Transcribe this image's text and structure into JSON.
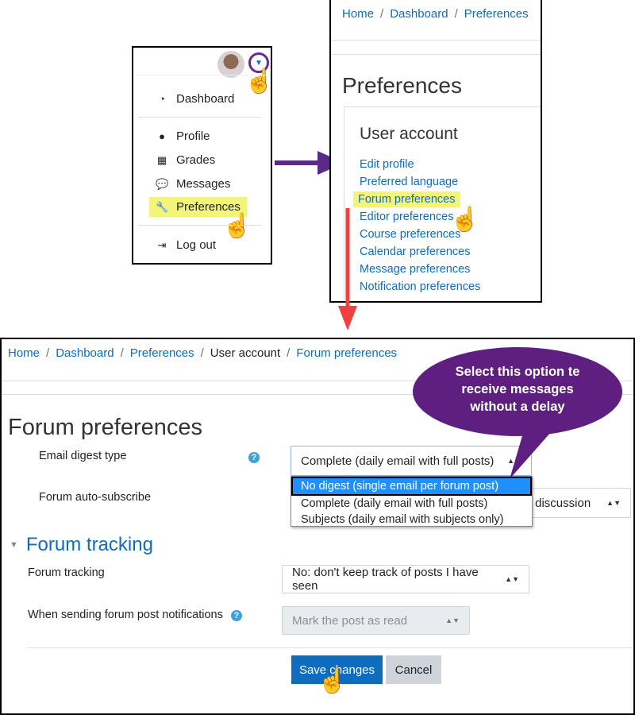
{
  "user_menu": {
    "items": [
      {
        "label": "Dashboard",
        "icon": "dashboard-icon"
      },
      {
        "label": "Profile",
        "icon": "user-icon"
      },
      {
        "label": "Grades",
        "icon": "table-icon"
      },
      {
        "label": "Messages",
        "icon": "comment-icon"
      },
      {
        "label": "Preferences",
        "icon": "wrench-icon"
      },
      {
        "label": "Log out",
        "icon": "sign-out-icon"
      }
    ]
  },
  "prefs_page": {
    "breadcrumb": [
      "Home",
      "Dashboard",
      "Preferences"
    ],
    "title": "Preferences",
    "section": "User account",
    "links": [
      "Edit profile",
      "Preferred language",
      "Forum preferences",
      "Editor preferences",
      "Course preferences",
      "Calendar preferences",
      "Message preferences",
      "Notification preferences"
    ]
  },
  "forum": {
    "breadcrumb": [
      "Home",
      "Dashboard",
      "Preferences",
      "User account",
      "Forum preferences"
    ],
    "title": "Forum preferences",
    "email_digest_label": "Email digest type",
    "email_digest_value": "Complete (daily email with full posts)",
    "email_digest_options": [
      "No digest (single email per forum post)",
      "Complete (daily email with full posts)",
      "Subjects (daily email with subjects only)"
    ],
    "auto_subscribe_label": "Forum auto-subscribe",
    "auto_subscribe_value_visible": "n discussion",
    "tracking_section": "Forum tracking",
    "tracking_label": "Forum tracking",
    "tracking_value": "No: don't keep track of posts I have seen",
    "notif_label": "When sending forum post notifications",
    "notif_value": "Mark the post as read",
    "save": "Save changes",
    "cancel": "Cancel"
  },
  "callout": "Select this option te receive messages without a delay",
  "colors": {
    "link": "#0f6cbf",
    "highlight": "#f2f57a",
    "callout": "#5f1f80",
    "arrow_purple": "#5a2a86",
    "arrow_red": "#f04040",
    "primary": "#0f6cbf"
  }
}
